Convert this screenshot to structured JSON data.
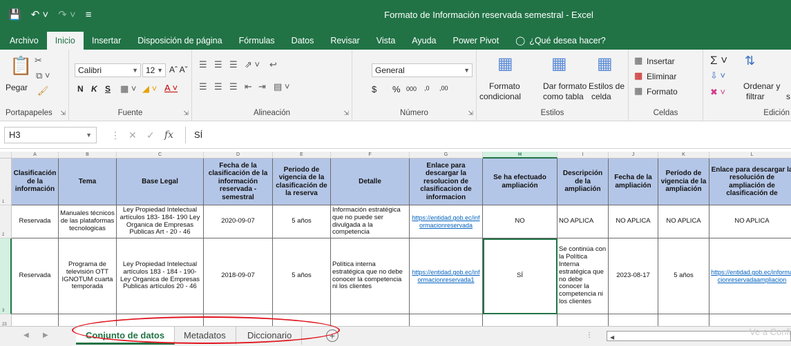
{
  "window": {
    "title": "Formato de Información reservada semestral  -  Excel",
    "qat_icons": [
      "save-icon",
      "undo-icon",
      "redo-icon",
      "customize-icon"
    ]
  },
  "tabs": [
    {
      "label": "Archivo",
      "active": false
    },
    {
      "label": "Inicio",
      "active": true
    },
    {
      "label": "Insertar",
      "active": false
    },
    {
      "label": "Disposición de página",
      "active": false
    },
    {
      "label": "Fórmulas",
      "active": false
    },
    {
      "label": "Datos",
      "active": false
    },
    {
      "label": "Revisar",
      "active": false
    },
    {
      "label": "Vista",
      "active": false
    },
    {
      "label": "Ayuda",
      "active": false
    },
    {
      "label": "Power Pivot",
      "active": false
    }
  ],
  "tell_me": "¿Qué desea hacer?",
  "ribbon": {
    "clipboard": {
      "paste": "Pegar",
      "label": "Portapapeles"
    },
    "font": {
      "name": "Calibri",
      "size": "12",
      "bold": "N",
      "italic": "K",
      "underline": "S",
      "label": "Fuente"
    },
    "alignment": {
      "label": "Alineación"
    },
    "number": {
      "format": "General",
      "currency": "$",
      "percent": "%",
      "thousands": "000",
      "inc_decimal": ",0",
      "dec_decimal": ",00",
      "label": "Número"
    },
    "styles": {
      "conditional_l1": "Formato",
      "conditional_l2": "condicional",
      "as_table_l1": "Dar formato",
      "as_table_l2": "como tabla",
      "cell_l1": "Estilos de",
      "cell_l2": "celda",
      "label": "Estilos"
    },
    "cells": {
      "insert": "Insertar",
      "delete": "Eliminar",
      "format": "Formato",
      "label": "Celdas"
    },
    "editing": {
      "sort_l1": "Ordenar y",
      "sort_l2": "filtrar",
      "sort_l3": "s",
      "label": "Edición"
    }
  },
  "formula_bar": {
    "name_box": "H3",
    "value": "SÍ"
  },
  "columns": [
    "A",
    "B",
    "C",
    "D",
    "E",
    "F",
    "G",
    "H",
    "I",
    "J",
    "K",
    "L"
  ],
  "selected_column": "H",
  "rows": [
    "1",
    "2",
    "3",
    "23"
  ],
  "headers": [
    "Clasificación de la información",
    "Tema",
    "Base Legal",
    "Fecha de la clasificación de la información reservada - semestral",
    "Periodo de vigencia de la clasificación de la reserva",
    "Detalle",
    "Enlace para descargar la resolucion de clasificacion de informacion",
    "Se ha efectuado ampliación",
    "Descripción de la ampliación",
    "Fecha de la ampliación",
    "Período de vigencia de la ampliación",
    "Enlace para descargar la resolución de ampliación de clasificación de"
  ],
  "data_rows": [
    [
      "Reservada",
      "Manuales técnicos de las plataformas tecnologicas",
      "Ley Propiedad Intelectual artículos 183- 184- 190 Ley Organica de Empresas Publicas Art - 20 - 46",
      "2020-09-07",
      "5 años",
      "Información estratégica que no puede ser divulgada a la competencia",
      "https://entidad.gob.ec/informacionreservada",
      "NO",
      "NO APLICA",
      "NO APLICA",
      "NO APLICA",
      "NO APLICA"
    ],
    [
      "Reservada",
      "Programa de televisión OTT IGNOTUM cuarta temporada",
      "Ley Propiedad Intelectual artículos 183 - 184 - 190- Ley Organica de Empresas Publicas artículos 20 - 46",
      "2018-09-07",
      "5 años",
      "Política interna estratégica que no debe conocer la competencia ni los clientes",
      "https://entidad.gob.ec/informacionreservada1",
      "SÍ",
      "Se continúa con la Política Interna estratégica que no debe conocer la competencia ni los clientes",
      "2023-08-17",
      "5 años",
      "https://entidad.gob.ec/informacionreservadaampliacion"
    ]
  ],
  "sheets": [
    {
      "label": "Conjunto de datos",
      "active": true
    },
    {
      "label": "Metadatos",
      "active": false
    },
    {
      "label": "Diccionario",
      "active": false
    }
  ],
  "watermark": "Ve a Confi",
  "colors": {
    "excel_green": "#217346",
    "header_fill": "#b4c6e7",
    "link": "#0563c1",
    "annotation": "#e0161f"
  }
}
